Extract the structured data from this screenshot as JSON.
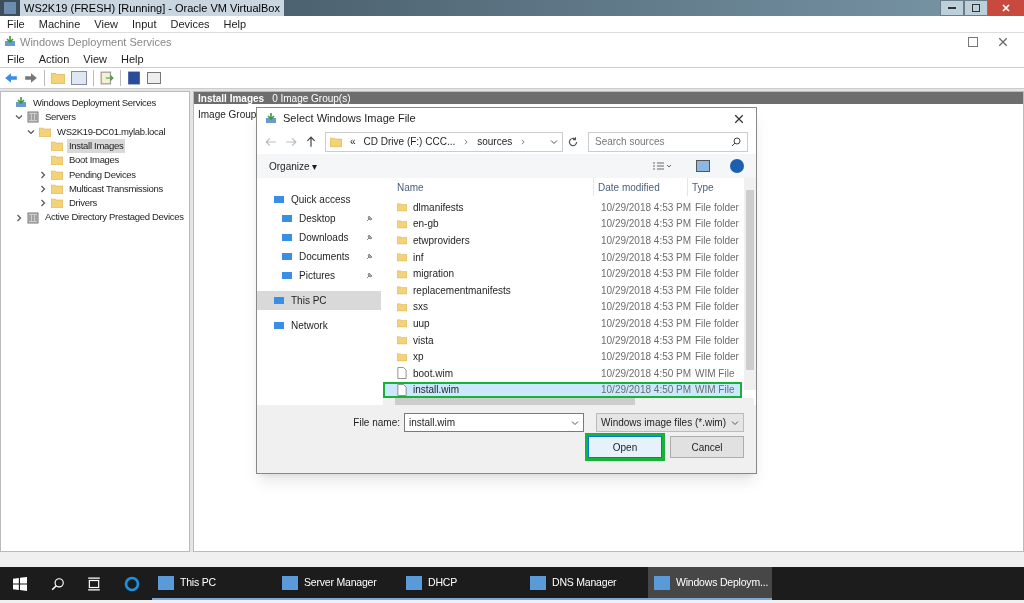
{
  "vbox": {
    "title": "WS2K19 (FRESH) [Running] - Oracle VM VirtualBox",
    "menu": [
      "File",
      "Machine",
      "View",
      "Input",
      "Devices",
      "Help"
    ]
  },
  "mmc": {
    "title": "Windows Deployment Services",
    "menu": [
      "File",
      "Action",
      "View",
      "Help"
    ],
    "tree": [
      {
        "label": "Windows Deployment Services",
        "selected": false,
        "children": [
          {
            "label": "Servers",
            "selected": false,
            "expanded": true,
            "children": [
              {
                "label": "WS2K19-DC01.mylab.local",
                "selected": false,
                "expanded": true,
                "children": [
                  {
                    "label": "Install Images",
                    "selected": true
                  },
                  {
                    "label": "Boot Images",
                    "selected": false
                  },
                  {
                    "label": "Pending Devices",
                    "selected": false,
                    "expanded": false
                  },
                  {
                    "label": "Multicast Transmissions",
                    "selected": false,
                    "expanded": false
                  },
                  {
                    "label": "Drivers",
                    "selected": false,
                    "expanded": false
                  }
                ]
              }
            ]
          },
          {
            "label": "Active Directory Prestaged Devices",
            "selected": false,
            "expanded": false
          }
        ]
      }
    ],
    "pane_title": "Install Images",
    "pane_count": "0 Image Group(s)",
    "column_1": "Image Group"
  },
  "dialog": {
    "title": "Select Windows Image File",
    "path": [
      "«",
      "CD Drive (F:) CCC...",
      "sources"
    ],
    "search": {
      "placeholder": "Search sources"
    },
    "organize": "Organize ▾",
    "nav": [
      {
        "label": "Quick access",
        "selected": false,
        "children": [
          {
            "label": "Desktop",
            "selected": false,
            "pinned": true
          },
          {
            "label": "Downloads",
            "selected": false,
            "pinned": true
          },
          {
            "label": "Documents",
            "selected": false,
            "pinned": true
          },
          {
            "label": "Pictures",
            "selected": false,
            "pinned": true
          }
        ]
      },
      {
        "label": "This PC",
        "selected": true
      },
      {
        "label": "Network",
        "selected": false
      }
    ],
    "columns": [
      "Name",
      "Date modified",
      "Type"
    ],
    "rows": [
      {
        "kind": "folder",
        "name": "dlmanifests",
        "date": "10/29/2018 4:53 PM",
        "type": "File folder",
        "selected": false,
        "outlined": false
      },
      {
        "kind": "folder",
        "name": "en-gb",
        "date": "10/29/2018 4:53 PM",
        "type": "File folder",
        "selected": false,
        "outlined": false
      },
      {
        "kind": "folder",
        "name": "etwproviders",
        "date": "10/29/2018 4:53 PM",
        "type": "File folder",
        "selected": false,
        "outlined": false
      },
      {
        "kind": "folder",
        "name": "inf",
        "date": "10/29/2018 4:53 PM",
        "type": "File folder",
        "selected": false,
        "outlined": false
      },
      {
        "kind": "folder",
        "name": "migration",
        "date": "10/29/2018 4:53 PM",
        "type": "File folder",
        "selected": false,
        "outlined": false
      },
      {
        "kind": "folder",
        "name": "replacementmanifests",
        "date": "10/29/2018 4:53 PM",
        "type": "File folder",
        "selected": false,
        "outlined": false
      },
      {
        "kind": "folder",
        "name": "sxs",
        "date": "10/29/2018 4:53 PM",
        "type": "File folder",
        "selected": false,
        "outlined": false
      },
      {
        "kind": "folder",
        "name": "uup",
        "date": "10/29/2018 4:53 PM",
        "type": "File folder",
        "selected": false,
        "outlined": false
      },
      {
        "kind": "folder",
        "name": "vista",
        "date": "10/29/2018 4:53 PM",
        "type": "File folder",
        "selected": false,
        "outlined": false
      },
      {
        "kind": "folder",
        "name": "xp",
        "date": "10/29/2018 4:53 PM",
        "type": "File folder",
        "selected": false,
        "outlined": false
      },
      {
        "kind": "file",
        "name": "boot.wim",
        "date": "10/29/2018 4:50 PM",
        "type": "WIM File",
        "selected": false,
        "outlined": false
      },
      {
        "kind": "file",
        "name": "install.wim",
        "date": "10/29/2018 4:50 PM",
        "type": "WIM File",
        "selected": true,
        "outlined": true
      }
    ],
    "file_name_label": "File name:",
    "file_name": "install.wim",
    "file_type": "Windows image files (*.wim)",
    "buttons": [
      {
        "label": "Open",
        "kind": "primary",
        "outlined": true
      },
      {
        "label": "Cancel",
        "kind": "secondary",
        "outlined": false
      }
    ]
  },
  "taskbar": {
    "apps": [
      {
        "label": "This PC",
        "selected": false
      },
      {
        "label": "Server Manager",
        "selected": false
      },
      {
        "label": "DHCP",
        "selected": false
      },
      {
        "label": "DNS Manager",
        "selected": false
      },
      {
        "label": "Windows Deploym...",
        "selected": true
      }
    ]
  }
}
